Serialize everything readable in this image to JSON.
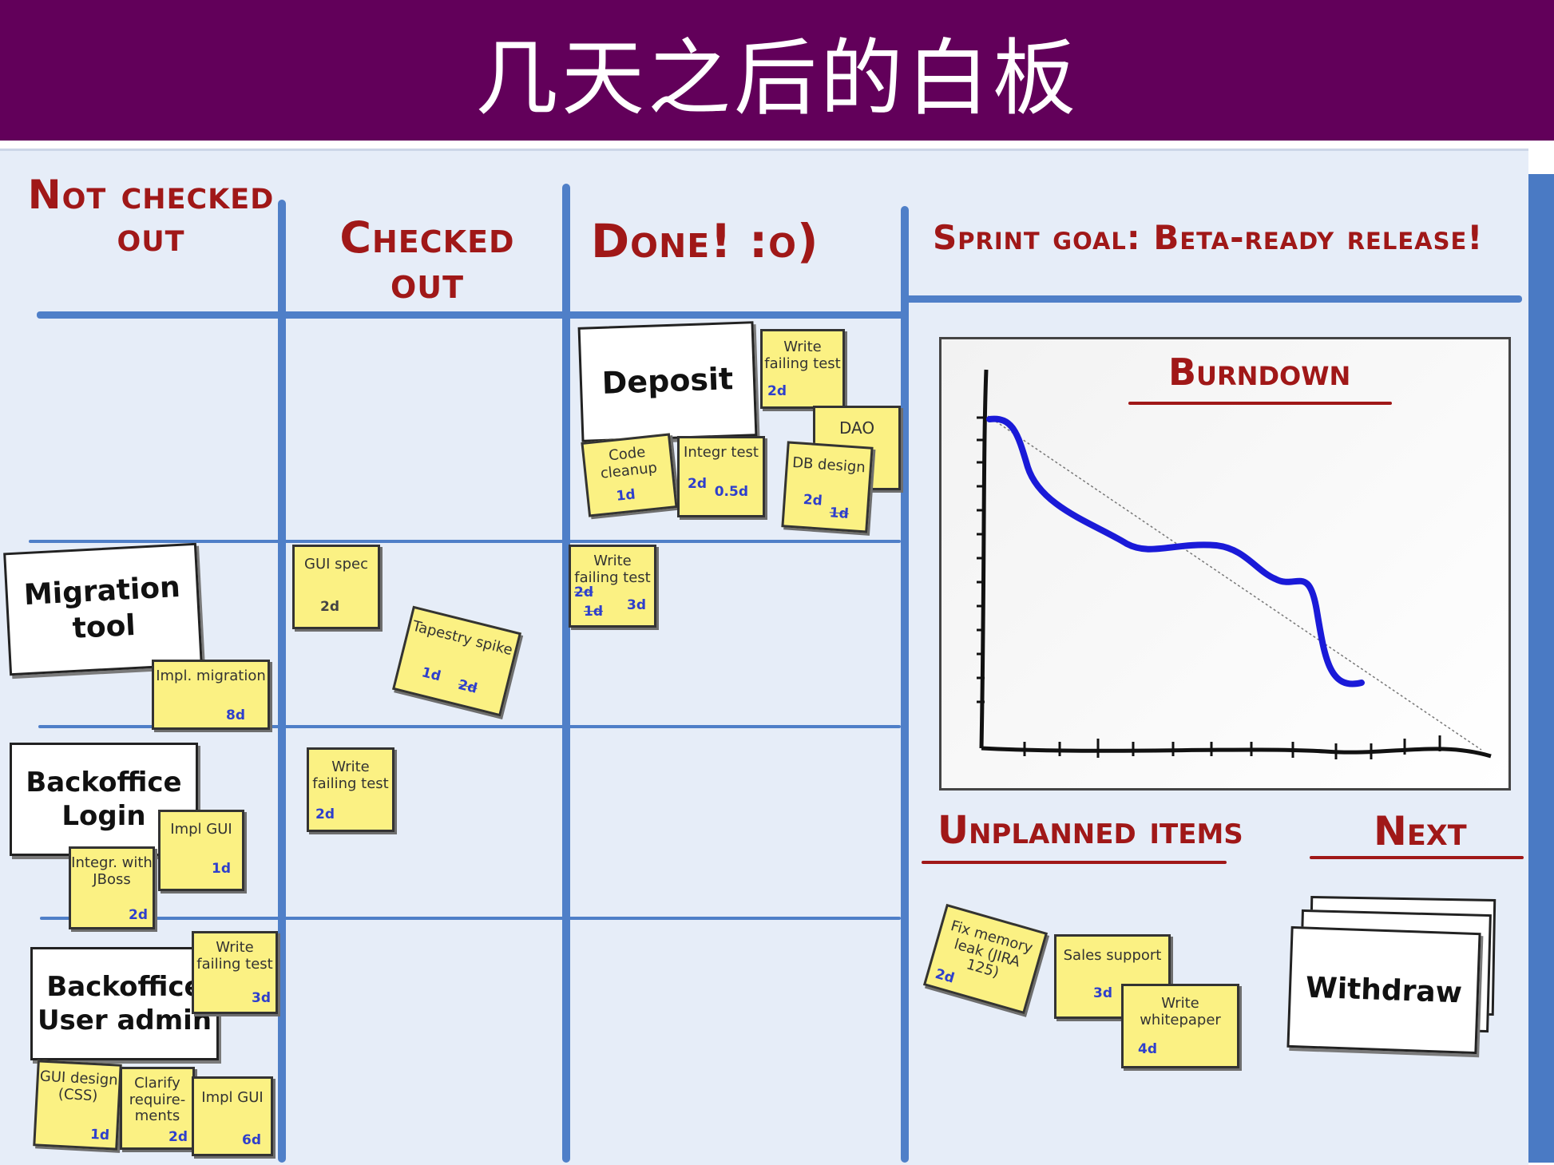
{
  "title": "几天之后的白板",
  "columns": {
    "not_checked_out": "Not checked out",
    "checked_out": "Checked out",
    "done": "Done! :o)",
    "sprint_goal": "Sprint goal: Beta-ready release!"
  },
  "stories": {
    "deposit": "Deposit",
    "migration_tool": "Migration tool",
    "backoffice_login": "Backoffice Login",
    "backoffice_user_admin": "Backoffice User admin",
    "withdraw": "Withdraw"
  },
  "notes": {
    "deposit_write_failing_test": {
      "text": "Write failing test",
      "est": "2d"
    },
    "deposit_dao": {
      "text": "DAO"
    },
    "deposit_code_cleanup": {
      "text": "Code cleanup",
      "est": "1d"
    },
    "deposit_integr_test": {
      "text": "Integr test",
      "est": "2d",
      "est2": "0.5d"
    },
    "deposit_db_design": {
      "text": "DB design",
      "est": "2d",
      "est2": "1d"
    },
    "migration_gui_spec": {
      "text": "GUI spec",
      "est": "2d"
    },
    "migration_tapestry_spike": {
      "text": "Tapestry spike",
      "est": "1d",
      "est2": "2d"
    },
    "migration_write_failing_test": {
      "text": "Write failing test",
      "est": "2d",
      "est2": "1d",
      "est3": "3d"
    },
    "migration_impl_migration": {
      "text": "Impl. migration",
      "est": "8d"
    },
    "login_write_failing_test": {
      "text": "Write failing test",
      "est": "2d"
    },
    "login_impl_gui": {
      "text": "Impl GUI",
      "est": "1d"
    },
    "login_integr_jboss": {
      "text": "Integr. with JBoss",
      "est": "2d"
    },
    "admin_write_failing_test": {
      "text": "Write failing test",
      "est": "3d"
    },
    "admin_gui_design": {
      "text": "GUI design (CSS)",
      "est": "1d"
    },
    "admin_clarify": {
      "text": "Clarify require-ments",
      "est": "2d"
    },
    "admin_impl_gui": {
      "text": "Impl GUI",
      "est": "6d"
    },
    "unplanned_fix_memory_leak": {
      "text": "Fix memory leak (JIRA 125)",
      "est": "2d"
    },
    "unplanned_sales_support": {
      "text": "Sales support",
      "est": "3d"
    },
    "unplanned_write_whitepaper": {
      "text": "Write whitepaper",
      "est": "4d"
    }
  },
  "burndown": {
    "title": "Burndown"
  },
  "sections": {
    "unplanned": "Unplanned items",
    "next": "Next"
  },
  "colors": {
    "banner": "#62005a",
    "lines": "#4f7fc8",
    "headings": "#a01818",
    "note": "#fbf183",
    "burn_line": "#1a1ad8"
  }
}
